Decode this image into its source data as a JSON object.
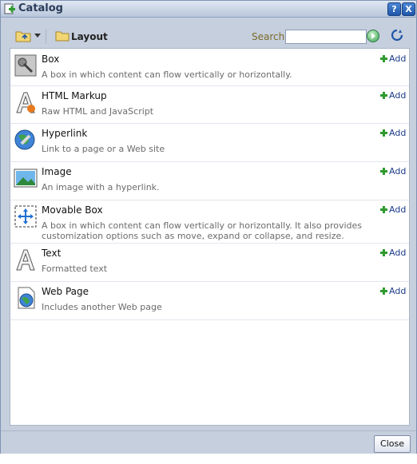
{
  "window": {
    "title": "Catalog",
    "help_label": "?",
    "close_label": "X"
  },
  "toolbar": {
    "layout_label": "Layout",
    "search_label": "Search",
    "search_value": "",
    "search_placeholder": ""
  },
  "items": [
    {
      "name": "Box",
      "description": "A box in which content can flow vertically or horizontally.",
      "add_label": "Add"
    },
    {
      "name": "HTML Markup",
      "description": "Raw HTML and JavaScript",
      "add_label": "Add"
    },
    {
      "name": "Hyperlink",
      "description": "Link to a page or a Web site",
      "add_label": "Add"
    },
    {
      "name": "Image",
      "description": "An image with a hyperlink.",
      "add_label": "Add"
    },
    {
      "name": "Movable Box",
      "description": "A box in which content can flow vertically or horizontally. It also provides customization options such as move, expand or collapse, and resize.",
      "add_label": "Add"
    },
    {
      "name": "Text",
      "description": "Formatted text",
      "add_label": "Add"
    },
    {
      "name": "Web Page",
      "description": "Includes another Web page",
      "add_label": "Add"
    }
  ],
  "footer": {
    "close_label": "Close"
  },
  "colors": {
    "accent": "#1f56a8",
    "add_green": "#2f9a2f",
    "link": "#1a3a8a"
  }
}
